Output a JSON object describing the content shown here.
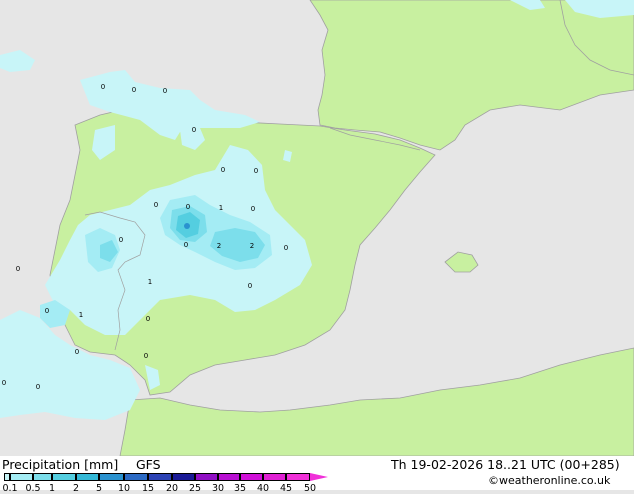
{
  "footer": {
    "title": "Precipitation [mm]",
    "model": "GFS",
    "valid_time": "Th 19-02-2026 18..21 UTC (00+285)",
    "credit": "©weatheronline.co.uk"
  },
  "legend": {
    "ticks": [
      "0.1",
      "0.5",
      "1",
      "2",
      "5",
      "10",
      "15",
      "20",
      "25",
      "30",
      "35",
      "40",
      "45",
      "50"
    ],
    "colors": [
      "#c8f5f8",
      "#a4ecf4",
      "#7cdeeb",
      "#54cee0",
      "#34b8d6",
      "#2a92cf",
      "#2c6ac4",
      "#2c42b4",
      "#1a1a96",
      "#9010c4",
      "#b810d2",
      "#d010d8",
      "#e020d4",
      "#f030d8"
    ]
  },
  "map_labels": [
    "0",
    "0",
    "0",
    "0",
    "0",
    "0",
    "0",
    "0",
    "1",
    "0",
    "2",
    "2",
    "0",
    "0",
    "1",
    "0",
    "0",
    "0",
    "0",
    "1",
    "0",
    "0",
    "0",
    "0",
    "0"
  ],
  "colors": {
    "sea": "#e6e6e6",
    "land": "#c8f0a0",
    "border": "#a0a0a0"
  }
}
